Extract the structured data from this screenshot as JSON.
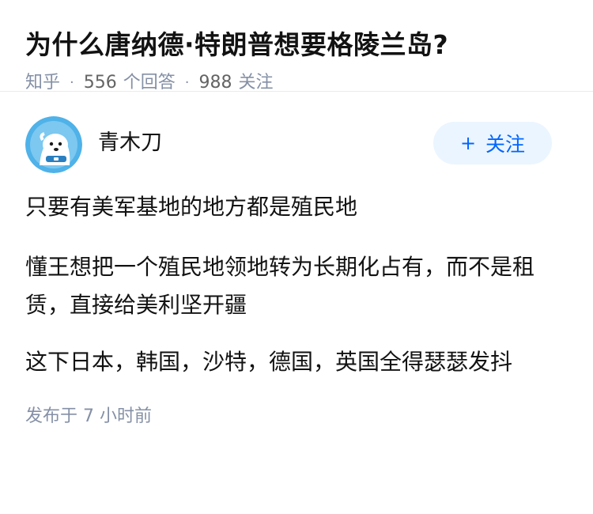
{
  "question": {
    "title": "为什么唐纳德·特朗普想要格陵兰岛?",
    "source": "知乎",
    "answer_count": "556",
    "answer_label": "个回答",
    "follower_count": "988",
    "follower_label": "关注"
  },
  "answer": {
    "author_name": "青木刀",
    "follow_label": "关注",
    "follow_icon": "plus-icon",
    "paragraphs": [
      "只要有美军基地的地方都是殖民地",
      "懂王想把一个殖民地领地转为长期化占有，而不是租赁，直接给美利坚开疆",
      "这下日本，韩国，沙特，德国，英国全得瑟瑟发抖"
    ],
    "published": "发布于  7 小时前"
  },
  "colors": {
    "accent": "#0066ff",
    "follow_bg": "#ebf5ff",
    "meta_text": "#8590a6",
    "avatar_bg": "#4fb2e8"
  }
}
